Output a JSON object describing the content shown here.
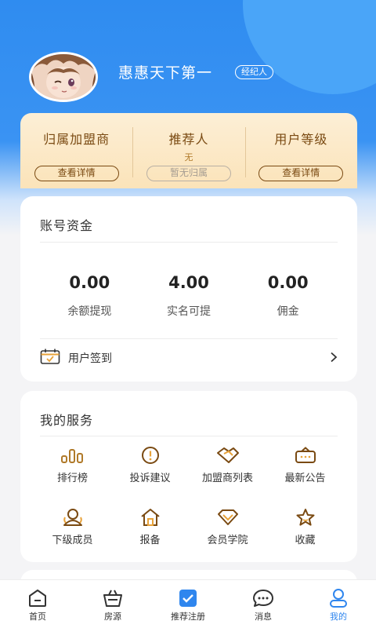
{
  "profile": {
    "username": "惠惠天下第一",
    "role_badge": "经纪人",
    "avatar_icon": "anime-girl-avatar"
  },
  "info": {
    "franchisee": {
      "title": "归属加盟商",
      "button": "查看详情"
    },
    "referrer": {
      "title": "推荐人",
      "value": "无",
      "button": "暂无归属"
    },
    "level": {
      "title": "用户等级",
      "button": "查看详情"
    }
  },
  "funds": {
    "title": "账号资金",
    "stats": [
      {
        "value": "0.00",
        "label": "余额提现"
      },
      {
        "value": "4.00",
        "label": "实名可提"
      },
      {
        "value": "0.00",
        "label": "佣金"
      }
    ],
    "checkin_label": "用户签到"
  },
  "services": {
    "title": "我的服务",
    "items": [
      {
        "label": "排行榜",
        "icon": "ranking-icon"
      },
      {
        "label": "投诉建议",
        "icon": "complaint-icon"
      },
      {
        "label": "加盟商列表",
        "icon": "handshake-icon"
      },
      {
        "label": "最新公告",
        "icon": "notice-icon"
      },
      {
        "label": "下级成员",
        "icon": "members-icon"
      },
      {
        "label": "报备",
        "icon": "house-icon"
      },
      {
        "label": "会员学院",
        "icon": "diamond-icon"
      },
      {
        "label": "收藏",
        "icon": "star-icon"
      }
    ]
  },
  "tabbar": {
    "items": [
      {
        "label": "首页",
        "icon": "home-icon"
      },
      {
        "label": "房源",
        "icon": "basket-icon"
      },
      {
        "label": "推荐注册",
        "icon": "check-icon"
      },
      {
        "label": "消息",
        "icon": "message-icon"
      },
      {
        "label": "我的",
        "icon": "profile-icon"
      }
    ],
    "active_index": 4
  },
  "colors": {
    "brand_blue": "#2f8cf0",
    "gold": "#7a4a12",
    "accent_icon": "#b07a2a",
    "active_tab": "#2f86ee"
  }
}
